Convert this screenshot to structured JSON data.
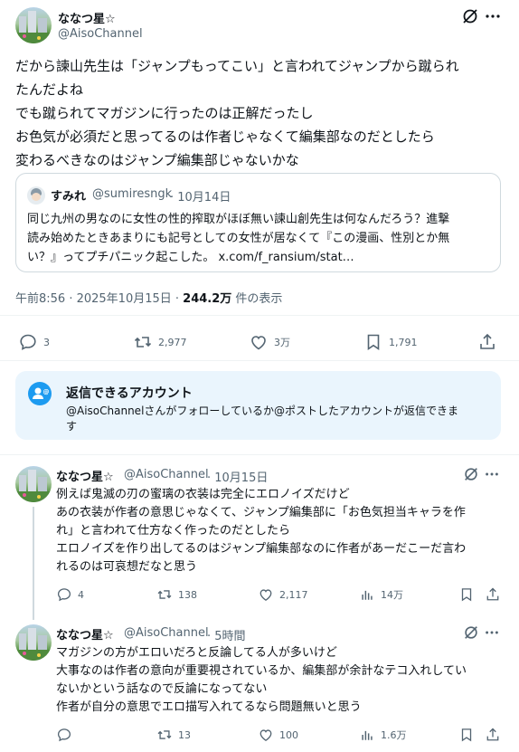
{
  "main_post": {
    "author_name": "ななつ星☆",
    "author_handle": "@AisoChannel",
    "text_lines": [
      "だから諫山先生は「ジャンプもってこい」と言われてジャンプから蹴られ",
      "たんだよね",
      "でも蹴られてマガジンに行ったのは正解だったし",
      "お色気が必須だと思ってるのは作者じゃなくて編集部なのだとしたら",
      "変わるべきなのはジャンプ編集部じゃないかな"
    ],
    "quote": {
      "author_name": "すみれ",
      "author_handle": "@sumiresngk",
      "date": "· 10月14日",
      "text_lines": [
        "同じ九州の男なのに女性の性的搾取がほぼ無い諫山創先生は何なんだろう？進撃",
        "読み始めたときあまりにも記号としての女性が居なくて『この漫画、性別とか無",
        "い？』ってプチパニック起こした。 x.com/f_ransium/stat…"
      ]
    },
    "timestamp": "午前8:56 · 2025年10月15日 · ",
    "views_count": "244.2万",
    "views_label": " 件の表示",
    "actions": {
      "replies": "3",
      "reposts": "2,977",
      "likes": "3万",
      "bookmarks": "1,791"
    }
  },
  "reply_notice": {
    "title": "返信できるアカウント",
    "body_lines": [
      "@AisoChannelさんがフォローしているか@ポストしたアカウントが返信できま",
      "す"
    ]
  },
  "replies": [
    {
      "author_name": "ななつ星☆",
      "author_handle": "@AisoChannel",
      "time": "· 10月15日",
      "text_lines": [
        "例えば鬼滅の刃の蜜璃の衣装は完全にエロノイズだけど",
        "あの衣装が作者の意思じゃなくて、ジャンプ編集部に「お色気担当キャラを作",
        "れ」と言われて仕方なく作ったのだとしたら",
        "エロノイズを作り出してるのはジャンプ編集部なのに作者があーだこーだ言わ",
        "れるのは可哀想だなと思う"
      ],
      "replies": "4",
      "reposts": "138",
      "likes": "2,117",
      "views": "14万"
    },
    {
      "author_name": "ななつ星☆",
      "author_handle": "@AisoChannel",
      "time": "· 5時間",
      "text_lines": [
        "マガジンの方がエロいだろと反論してる人が多いけど",
        "大事なのは作者の意向が重要視されているか、編集部が余計なテコ入れしてい",
        "ないかという話なので反論になってない",
        "作者が自分の意思でエロ描写入れてるなら問題無いと思う"
      ],
      "replies": "",
      "reposts": "13",
      "likes": "100",
      "views": "1.6万"
    }
  ],
  "colors": {
    "accent": "#1d9bf0",
    "text": "#0f1419",
    "muted": "#536471",
    "border": "#cfd9de",
    "notice_bg": "#eaf5fd"
  },
  "icons": [
    "grok-icon",
    "more-icon",
    "reply-icon",
    "repost-icon",
    "like-icon",
    "bookmark-icon",
    "share-icon",
    "views-icon",
    "account-icon"
  ]
}
